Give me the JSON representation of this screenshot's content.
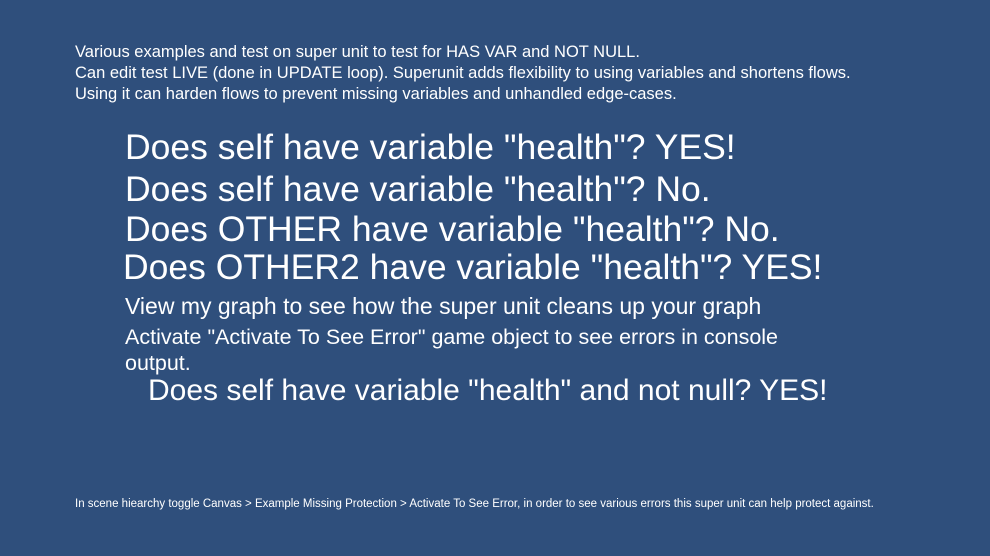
{
  "colors": {
    "background": "#2f4f7c",
    "text": "#ffffff"
  },
  "intro": {
    "line1": "Various examples and test on super unit to test for HAS VAR and NOT NULL.",
    "line2": "Can edit test LIVE (done in UPDATE loop). Superunit adds flexibility to using variables and shortens flows. Using it can harden flows to prevent missing variables and unhandled edge-cases."
  },
  "results": {
    "self_health": "Does self have variable \"health\"? YES!",
    "self_health_2": "Does self have variable \"health\"? No.",
    "other_health": "Does OTHER have variable \"health\"? No.",
    "other2_health": "Does OTHER2 have variable \"health\"? YES!",
    "self_health_not_null": "Does self have variable \"health\" and not null? YES!"
  },
  "notes": {
    "view_graph": "View my graph to see how the super unit cleans up your graph",
    "activate_error": "Activate \"Activate To See Error\" game object to see errors in console output.",
    "footer": "In scene hiearchy toggle Canvas > Example Missing Protection > Activate To See Error, in order to see various errors this super unit can help protect against."
  }
}
